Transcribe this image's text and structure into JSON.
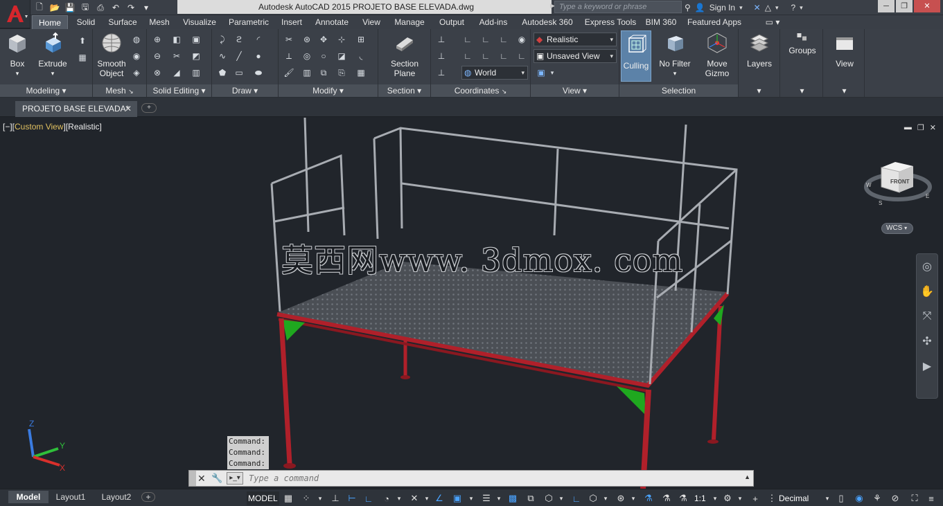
{
  "window": {
    "title": "Autodesk AutoCAD 2015    PROJETO BASE ELEVADA.dwg",
    "search_placeholder": "Type a keyword or phrase",
    "sign_in": "Sign In"
  },
  "ribbon_tabs": [
    "Home",
    "Solid",
    "Surface",
    "Mesh",
    "Visualize",
    "Parametric",
    "Insert",
    "Annotate",
    "View",
    "Manage",
    "Output",
    "Add-ins",
    "Autodesk 360",
    "Express Tools",
    "BIM 360",
    "Featured Apps"
  ],
  "active_ribbon_tab": "Home",
  "panels": {
    "modeling": {
      "title": "Modeling",
      "box": "Box",
      "extrude": "Extrude"
    },
    "mesh": {
      "title": "Mesh",
      "smooth_object_1": "Smooth",
      "smooth_object_2": "Object"
    },
    "solid_editing": {
      "title": "Solid Editing"
    },
    "draw": {
      "title": "Draw"
    },
    "modify": {
      "title": "Modify"
    },
    "section": {
      "title": "Section",
      "section_plane_1": "Section",
      "section_plane_2": "Plane"
    },
    "coordinates": {
      "title": "Coordinates",
      "ucs_select": "World"
    },
    "view": {
      "title": "View",
      "visual_style": "Realistic",
      "named_view": "Unsaved View"
    },
    "selection": {
      "title": "Selection",
      "culling": "Culling",
      "no_filter": "No Filter",
      "move_gizmo_1": "Move",
      "move_gizmo_2": "Gizmo"
    },
    "layers": {
      "label": "Layers"
    },
    "groups": {
      "label": "Groups"
    },
    "view_btn": {
      "label": "View"
    }
  },
  "document_tab": "PROJETO BASE ELEVADA*",
  "viewport": {
    "label_prefix": "[−][",
    "label_view": "Custom View",
    "label_suffix": "][Realistic]",
    "watermark": "莫西网www. 3dmox. com",
    "viewcube_face": "FRONT",
    "wcs": "WCS",
    "compass": {
      "w": "W",
      "s": "S",
      "e": "E"
    },
    "ucs_axes": {
      "x": "X",
      "y": "Y",
      "z": "Z"
    }
  },
  "command_history": [
    "Command:",
    "Command:",
    "Command:"
  ],
  "command_placeholder": "Type a command",
  "layout_tabs": [
    "Model",
    "Layout1",
    "Layout2"
  ],
  "active_layout": "Model",
  "status": {
    "model": "MODEL",
    "scale": "1:1",
    "units": "Decimal"
  },
  "colors": {
    "accent": "#4aa3ff",
    "frame_red": "#b0202a",
    "gusset_green": "#1fa81f",
    "rail_grey": "#a8acb2",
    "current_view": "#e0c060"
  }
}
